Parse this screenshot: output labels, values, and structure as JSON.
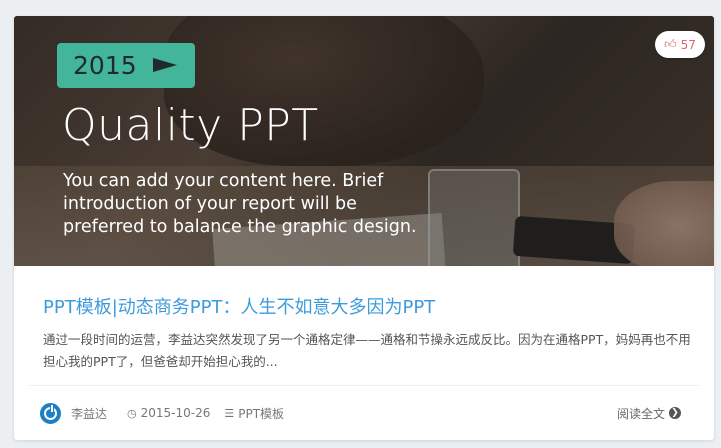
{
  "hero": {
    "year": "2015",
    "title": "Quality PPT",
    "description": "You can add your content here. Brief introduction of your report will be preferred to balance the graphic design."
  },
  "likes": {
    "icon": "thumbs-up-icon",
    "count": "57"
  },
  "article": {
    "title": "PPT模板|动态商务PPT：人生不如意大多因为PPT",
    "excerpt": "通过一段时间的运营，李益达突然发现了另一个通格定律——通格和节操永远成反比。因为在通格PPT，妈妈再也不用担心我的PPT了，但爸爸却开始担心我的..."
  },
  "meta": {
    "author": "李益达",
    "date": "2015-10-26",
    "category": "PPT模板",
    "read_more": "阅读全文"
  },
  "colors": {
    "accent": "#3d9bdc",
    "badge": "#43b59a",
    "like": "#e06666",
    "avatar": "#1e7ec6"
  }
}
